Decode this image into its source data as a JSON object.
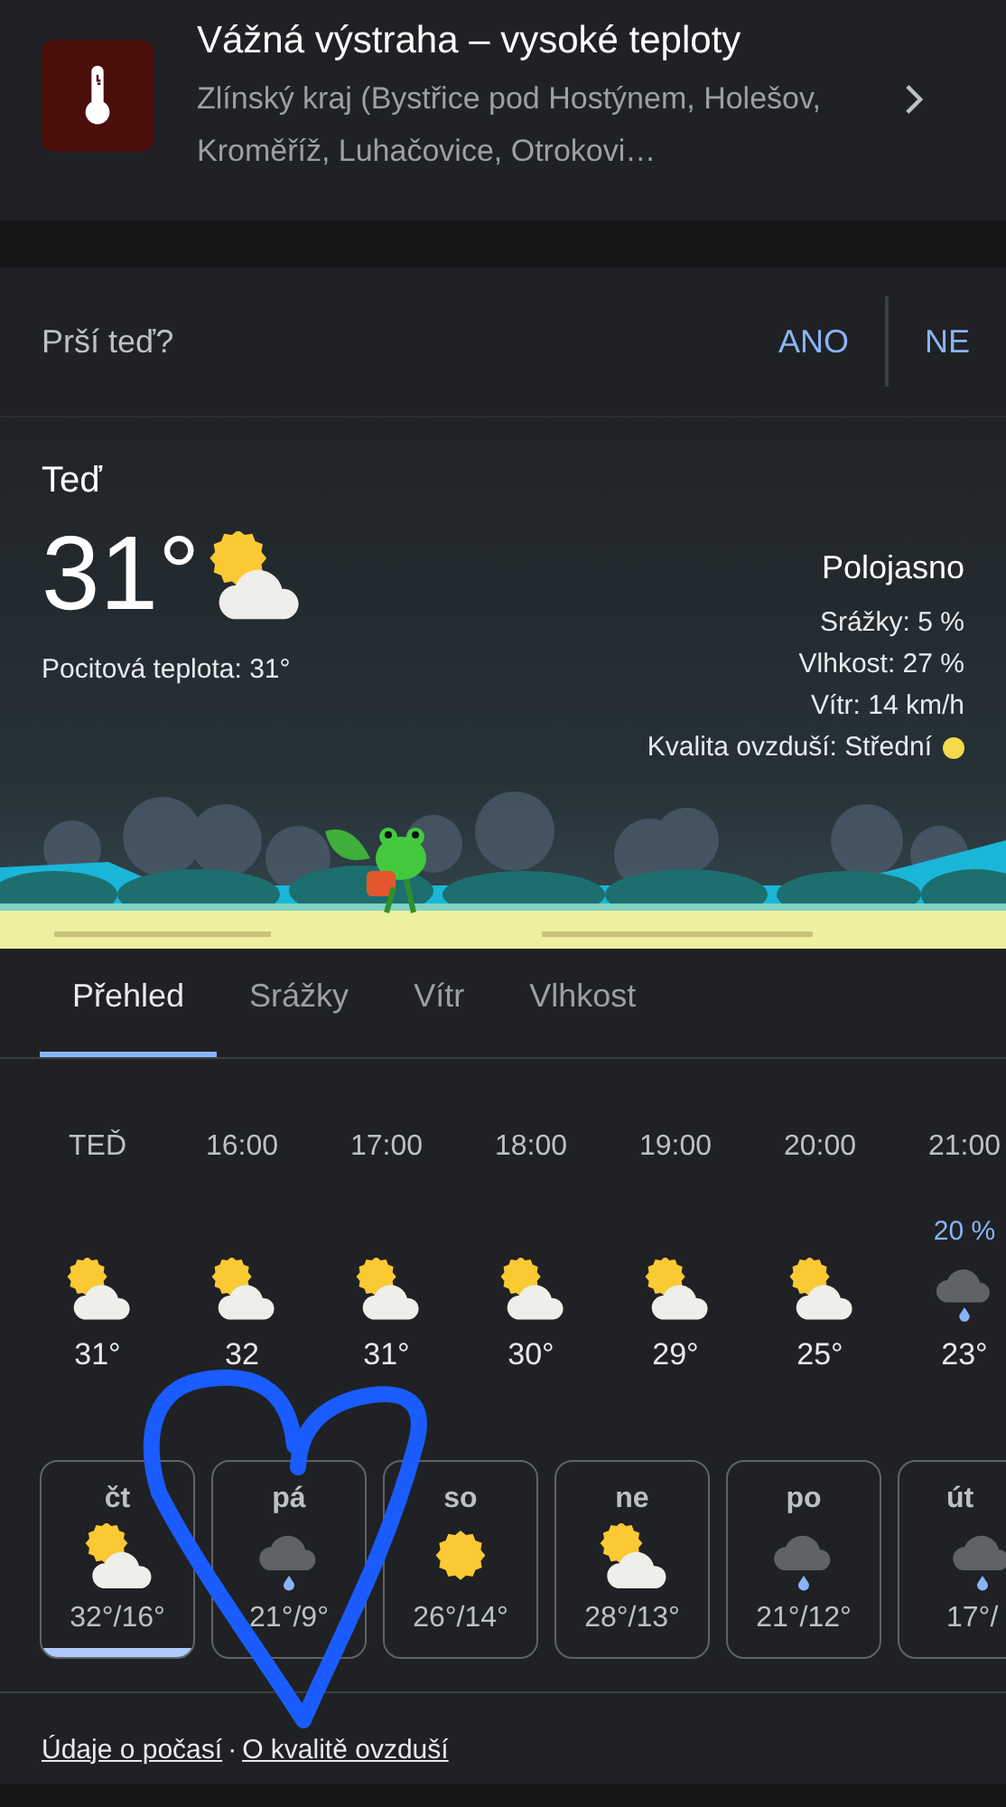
{
  "alert": {
    "title": "Vážná výstraha – vysoké teploty",
    "subtitle": "Zlínský kraj (Bystřice pod Hostýnem, Holešov, Kroměříž, Luhačovice, Otrokovi…"
  },
  "rain_question": {
    "label": "Prší teď?",
    "buttons": [
      "ANO",
      "NE"
    ]
  },
  "now": {
    "label": "Teď",
    "temperature": "31°",
    "kind": "partly_cloudy",
    "feels_like": "Pocitová teplota: 31°",
    "condition": "Polojasno",
    "details": [
      {
        "text": "Srážky: 5 %"
      },
      {
        "text": "Vlhkost: 27 %"
      },
      {
        "text": "Vítr: 14 km/h"
      },
      {
        "text": "Kvalita ovzduší: Střední",
        "color": "#f5d94a"
      }
    ]
  },
  "tabs": [
    {
      "label": "Přehled",
      "selected": true
    },
    {
      "label": "Srážky",
      "selected": false
    },
    {
      "label": "Vítr",
      "selected": false
    },
    {
      "label": "Vlhkost",
      "selected": false
    }
  ],
  "hourly": [
    {
      "time": "TEĎ",
      "kind": "partly_cloudy",
      "temp": "31°"
    },
    {
      "time": "16:00",
      "kind": "partly_cloudy",
      "temp": "32"
    },
    {
      "time": "17:00",
      "kind": "partly_cloudy",
      "temp": "31°"
    },
    {
      "time": "18:00",
      "kind": "partly_cloudy",
      "temp": "30°"
    },
    {
      "time": "19:00",
      "kind": "partly_cloudy",
      "temp": "29°"
    },
    {
      "time": "20:00",
      "kind": "partly_cloudy",
      "temp": "25°"
    },
    {
      "time": "21:00",
      "precip": "20 %",
      "kind": "rain",
      "temp": "23°"
    }
  ],
  "days": [
    {
      "day": "čt",
      "kind": "partly_cloudy",
      "temps": "32°/16°",
      "selected": true
    },
    {
      "day": "pá",
      "kind": "rain",
      "temps": "21°/9°",
      "selected": false
    },
    {
      "day": "so",
      "kind": "sunny",
      "temps": "26°/14°",
      "selected": false
    },
    {
      "day": "ne",
      "kind": "partly_cloudy",
      "temps": "28°/13°",
      "selected": false
    },
    {
      "day": "po",
      "kind": "rain",
      "temps": "21°/12°",
      "selected": false
    },
    {
      "day": "út",
      "kind": "rain",
      "temps": "17°/",
      "selected": false
    }
  ],
  "footer_links": [
    "Údaje o počasí",
    "O kvalitě ovzduší"
  ],
  "footer_separator": "·",
  "overlay_drawing": {
    "kind": "heart"
  }
}
